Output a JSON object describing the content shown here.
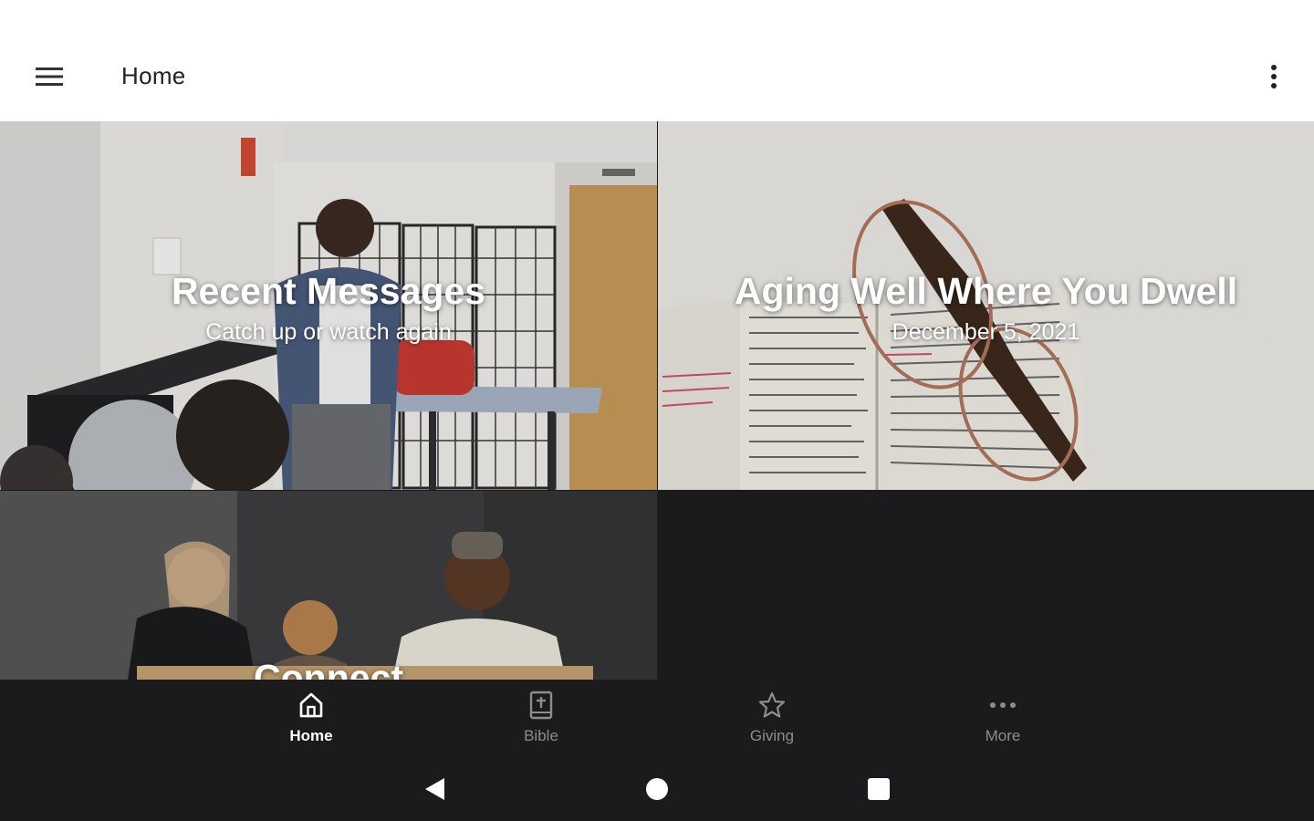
{
  "app_bar": {
    "title": "Home",
    "menu_icon": "hamburger-menu-icon",
    "overflow_icon": "more-vertical-icon",
    "background": "#ffffff"
  },
  "tiles": [
    {
      "title": "Recent Messages",
      "subtitle": "Catch up or watch again"
    },
    {
      "title": "Aging Well Where You Dwell",
      "subtitle": "December 5, 2021"
    },
    {
      "title": "Connect"
    }
  ],
  "bottom_nav": {
    "items": [
      {
        "label": "Home",
        "icon": "home-icon",
        "active": true
      },
      {
        "label": "Bible",
        "icon": "bible-icon",
        "active": false
      },
      {
        "label": "Giving",
        "icon": "star-icon",
        "active": false
      },
      {
        "label": "More",
        "icon": "more-horizontal-icon",
        "active": false
      }
    ],
    "active_color": "#ffffff",
    "inactive_color": "#8d8d8d",
    "background": "#1b1b1d"
  },
  "system_nav": {
    "back_icon": "back-triangle-icon",
    "home_icon": "home-circle-icon",
    "recents_icon": "recents-square-icon"
  }
}
